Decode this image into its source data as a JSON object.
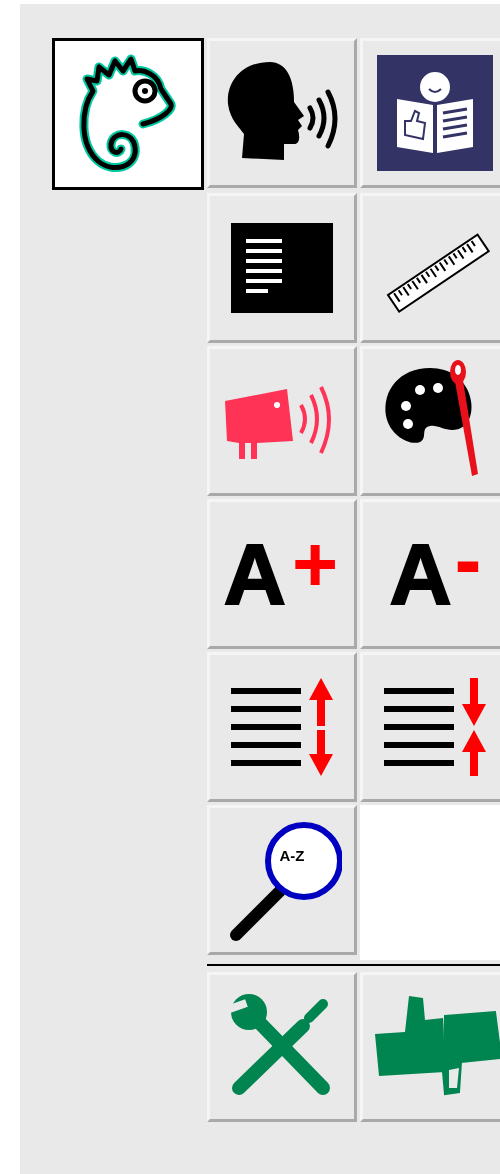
{
  "logo": {
    "kind": "chameleon",
    "selected": true
  },
  "tool_buttons": [
    {
      "kind": "speak"
    },
    {
      "kind": "easy-read"
    },
    {
      "kind": "contrast"
    },
    {
      "kind": "ruler"
    },
    {
      "kind": "sound"
    },
    {
      "kind": "palette"
    },
    {
      "kind": "text-size",
      "text": "A",
      "sign": "+"
    },
    {
      "kind": "text-size",
      "text": "A",
      "sign": "-"
    },
    {
      "kind": "line-spacing-increase"
    },
    {
      "kind": "line-spacing-decrease"
    },
    {
      "kind": "glossary",
      "text": "A-Z"
    }
  ],
  "footer_buttons": [
    {
      "kind": "tools"
    },
    {
      "kind": "feedback"
    }
  ]
}
